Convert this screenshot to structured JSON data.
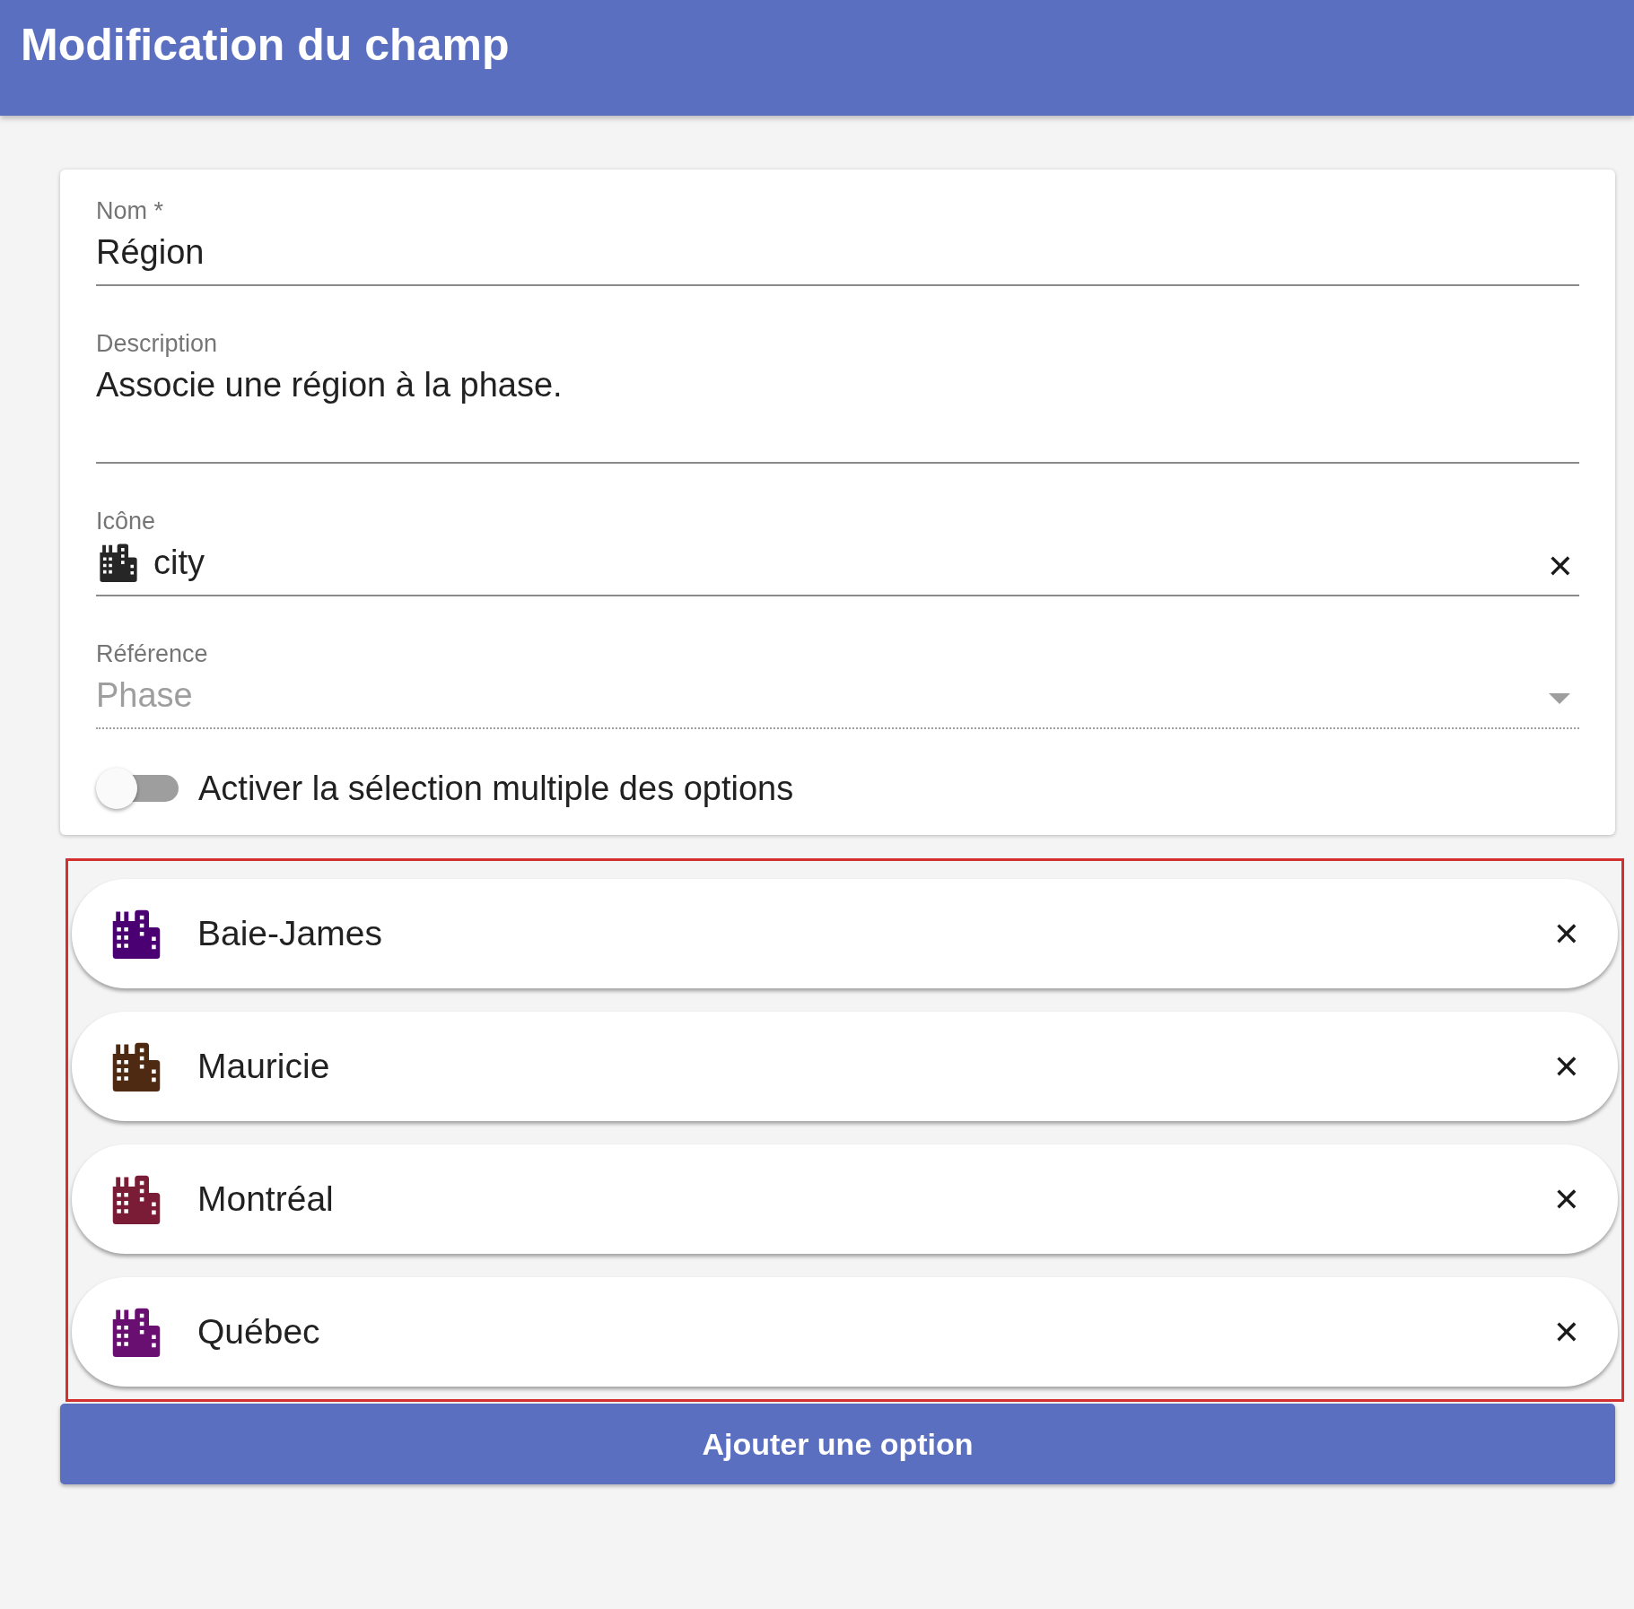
{
  "header": {
    "title": "Modification du champ"
  },
  "form": {
    "name": {
      "label": "Nom *",
      "value": "Région"
    },
    "description": {
      "label": "Description",
      "value": "Associe une région à la phase."
    },
    "icon": {
      "label": "Icône",
      "value": "city",
      "clear": "✕"
    },
    "reference": {
      "label": "Référence",
      "value": "Phase",
      "disabled": true
    },
    "multiple_selection": {
      "label": "Activer la sélection multiple des options",
      "on": false
    }
  },
  "options": [
    {
      "label": "Baie-James",
      "color": "#4a0072",
      "remove": "✕"
    },
    {
      "label": "Mauricie",
      "color": "#4e2a12",
      "remove": "✕"
    },
    {
      "label": "Montréal",
      "color": "#7b1c36",
      "remove": "✕"
    },
    {
      "label": "Québec",
      "color": "#6a0f72",
      "remove": "✕"
    }
  ],
  "add_button": "Ajouter une option"
}
